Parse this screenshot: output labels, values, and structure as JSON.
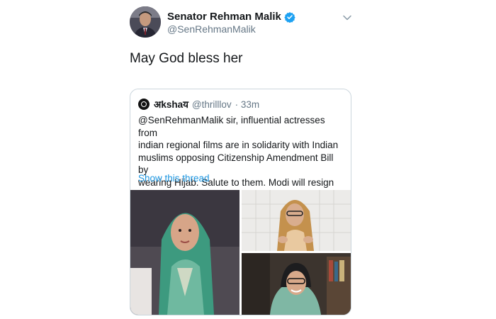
{
  "author": {
    "display_name": "Senator Rehman Malik",
    "handle": "@SenRehmanMalik"
  },
  "tweet": {
    "text": "May God bless her"
  },
  "quoted_tweet": {
    "display_name": "अkshaय",
    "handle": "@thrilllov",
    "time": "· 33m",
    "text": "@SenRehmanMalik sir, influential actresses from\nindian regional films are in solidarity with Indian\nmuslims opposing Citizenship Amendment Bill by\nwearing Hijab. Salute to them. Modi will resign\nsoon.",
    "show_thread_label": "Show this thread"
  },
  "colors": {
    "link": "#1b95e0",
    "verified": "#1da1f2",
    "secondary_text": "#657786",
    "border": "#ccd6dd"
  },
  "icons": [
    "verified-badge-icon",
    "chevron-down-icon"
  ]
}
